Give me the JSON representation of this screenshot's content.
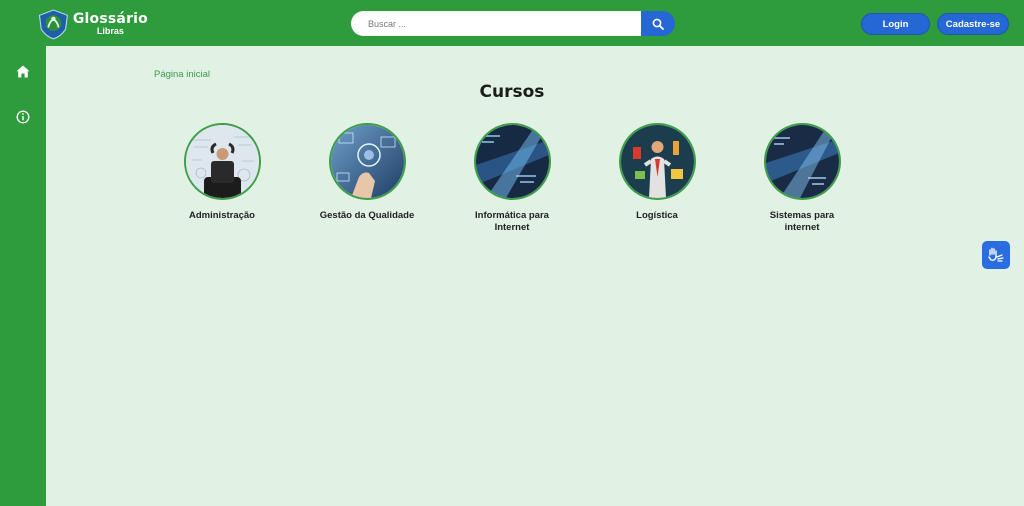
{
  "header": {
    "logo_title": "Glossário",
    "logo_subtitle": "Libras",
    "search": {
      "placeholder": "Buscar ..."
    },
    "login_label": "Login",
    "signup_label": "Cadastre-se"
  },
  "sidebar": {
    "items": [
      {
        "icon": "home-icon"
      },
      {
        "icon": "info-icon"
      }
    ]
  },
  "main": {
    "breadcrumb": "Página inicial",
    "title": "Cursos",
    "courses": [
      {
        "label": "Administração"
      },
      {
        "label": "Gestão da Qualidade"
      },
      {
        "label": "Informática para Internet"
      },
      {
        "label": "Logística"
      },
      {
        "label": "Sistemas para internet"
      }
    ]
  },
  "colors": {
    "green": "#2e9b3c",
    "background": "#e1f2e4",
    "blue": "#2567d4"
  }
}
